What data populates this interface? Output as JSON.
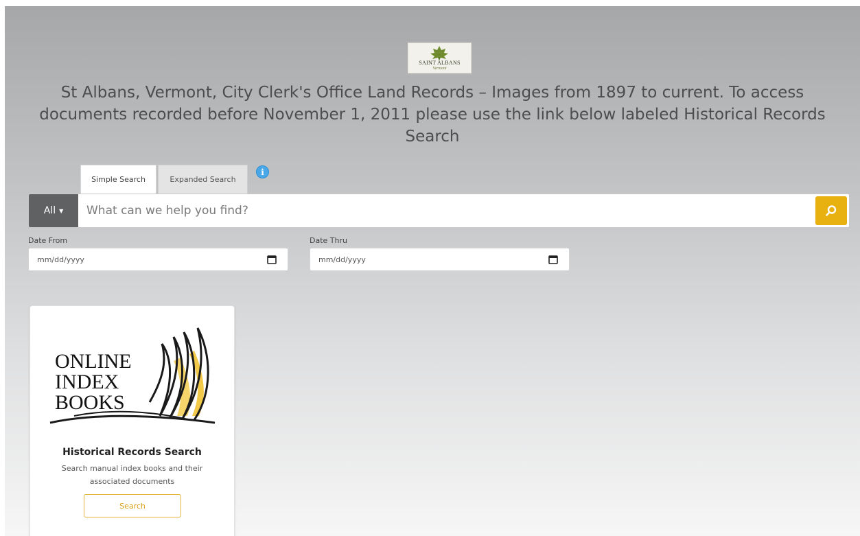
{
  "header": {
    "logo_text": "SAINT ALBANS",
    "logo_subtext": "Vermont",
    "headline": "St Albans, Vermont, City Clerk's Office Land Records – Images from 1897 to current. To access documents recorded before November 1, 2011 please use the link below labeled Historical Records Search"
  },
  "tabs": [
    {
      "label": "Simple Search",
      "active": true
    },
    {
      "label": "Expanded Search",
      "active": false
    }
  ],
  "search": {
    "scope": "All",
    "placeholder": "What can we help you find?",
    "value": ""
  },
  "dates": {
    "from_label": "Date From",
    "from_placeholder": "mm/dd/yyyy",
    "thru_label": "Date Thru",
    "thru_placeholder": "mm/dd/yyyy"
  },
  "card": {
    "logo_lines": [
      "ONLINE",
      "INDEX",
      "BOOKS"
    ],
    "title": "Historical Records Search",
    "description": "Search manual index books and their associated documents",
    "button_label": "Search"
  },
  "colors": {
    "accent": "#e8b10f",
    "scope_bg": "#5f6163",
    "info": "#4aa8e8"
  },
  "icons": {
    "info": "info-icon",
    "search": "magnifier-icon",
    "calendar": "calendar-icon"
  }
}
